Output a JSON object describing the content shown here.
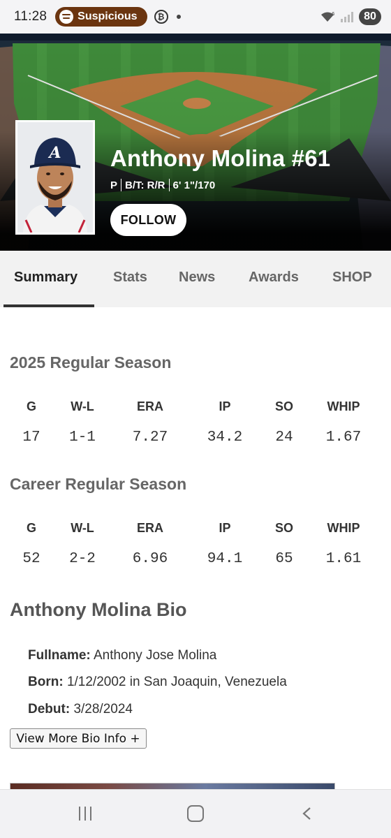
{
  "status_bar": {
    "time": "11:28",
    "media_pill": "Suspicious",
    "battery": "80",
    "pill_color": "#6b3510"
  },
  "player": {
    "name": "Anthony Molina #61",
    "position": "P",
    "bats_throws": "B/T: R/R",
    "height_weight": "6' 1\"/170",
    "follow_label": "FOLLOW"
  },
  "tabs": [
    {
      "label": "Summary",
      "active": true
    },
    {
      "label": "Stats"
    },
    {
      "label": "News"
    },
    {
      "label": "Awards"
    },
    {
      "label": "SHOP"
    }
  ],
  "season": {
    "title": "2025 Regular Season",
    "headers": [
      "G",
      "W-L",
      "ERA",
      "IP",
      "SO",
      "WHIP"
    ],
    "values": [
      "17",
      "1-1",
      "7.27",
      "34.2",
      "24",
      "1.67"
    ]
  },
  "career": {
    "title": "Career Regular Season",
    "headers": [
      "G",
      "W-L",
      "ERA",
      "IP",
      "SO",
      "WHIP"
    ],
    "values": [
      "52",
      "2-2",
      "6.96",
      "94.1",
      "65",
      "1.61"
    ]
  },
  "bio": {
    "title": "Anthony Molina Bio",
    "fullname_label": "Fullname:",
    "fullname": "Anthony Jose Molina",
    "born_label": "Born:",
    "born": "1/12/2002 in San Joaquin, Venezuela",
    "debut_label": "Debut:",
    "debut": "3/28/2024",
    "more_button": "View More Bio Info +"
  },
  "navbar": {
    "icons": [
      "recents-icon",
      "home-icon",
      "back-icon"
    ]
  }
}
